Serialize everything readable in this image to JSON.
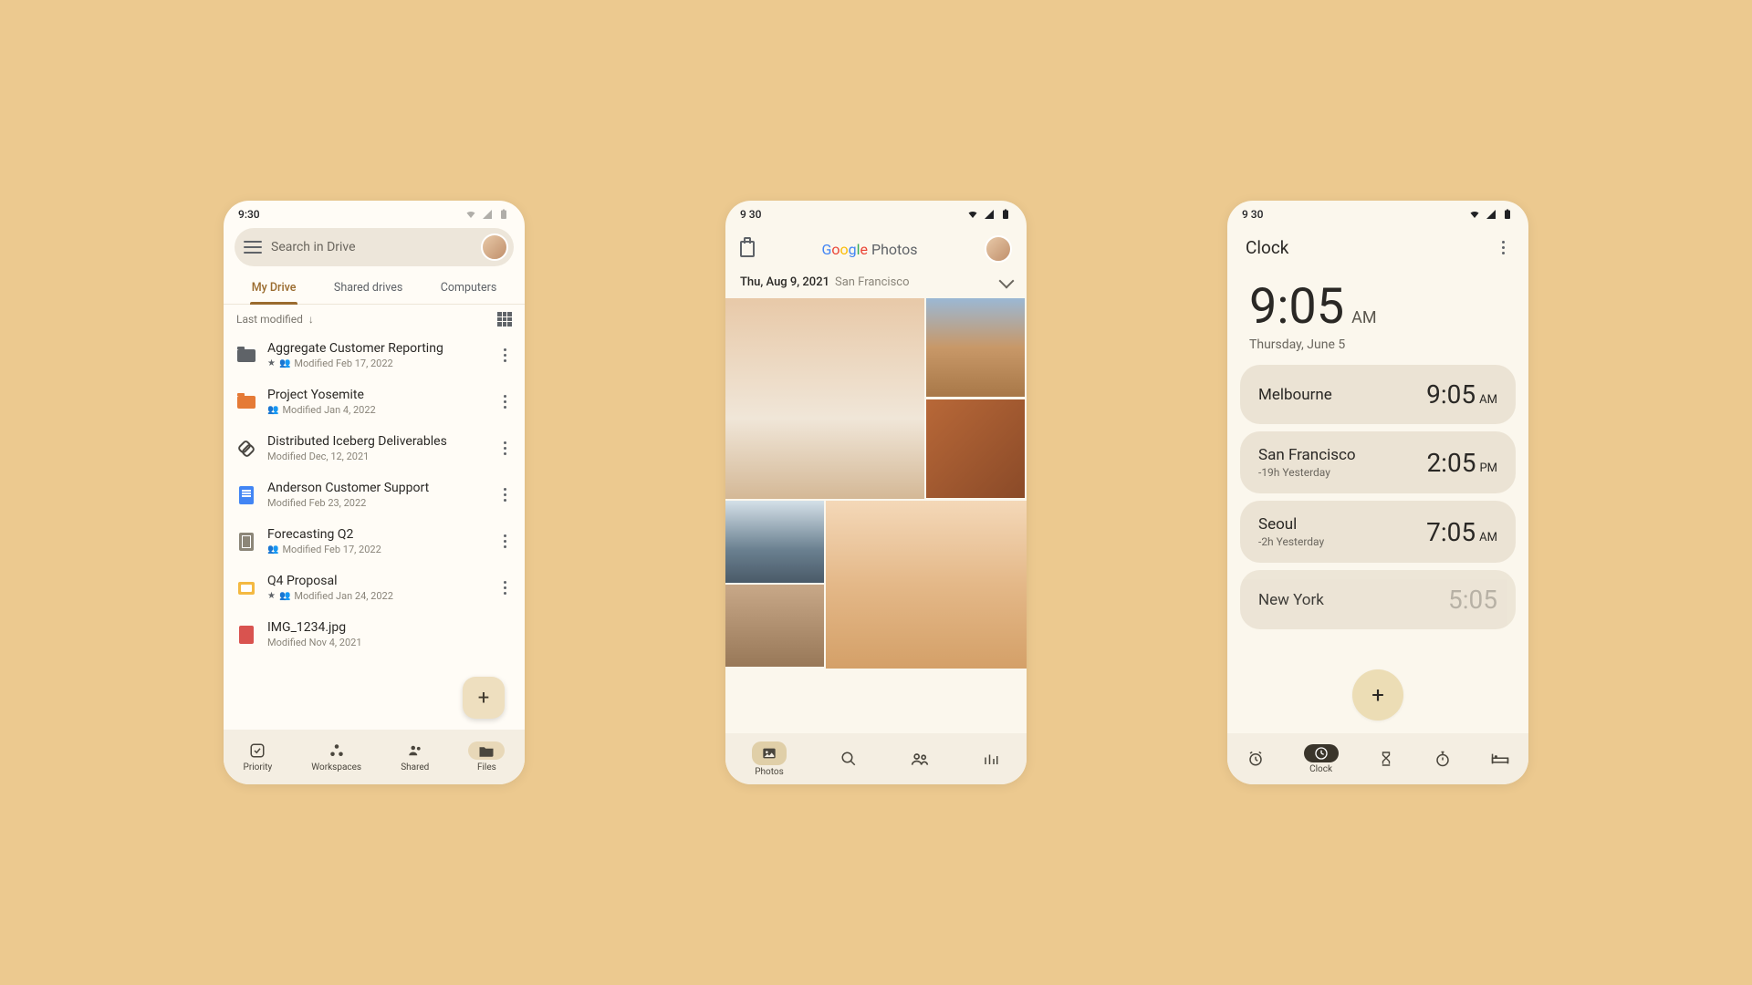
{
  "drive": {
    "status_time": "9:30",
    "search_placeholder": "Search in Drive",
    "tabs": [
      "My Drive",
      "Shared drives",
      "Computers"
    ],
    "sort_label": "Last modified",
    "files": [
      {
        "name": "Aggregate Customer Reporting",
        "meta": "Modified Feb 17, 2022",
        "starred": true,
        "shared": true
      },
      {
        "name": "Project Yosemite",
        "meta": "Modified Jan 4, 2022",
        "shared": true
      },
      {
        "name": "Distributed Iceberg Deliverables",
        "meta": "Modified Dec, 12, 2021"
      },
      {
        "name": "Anderson Customer Support",
        "meta": "Modified Feb 23, 2022"
      },
      {
        "name": "Forecasting Q2",
        "meta": "Modified Feb 17, 2022",
        "shared": true
      },
      {
        "name": "Q4 Proposal",
        "meta": "Modified Jan 24, 2022",
        "starred": true,
        "shared": true
      },
      {
        "name": "IMG_1234.jpg",
        "meta": "Modified Nov 4, 2021"
      }
    ],
    "nav": [
      "Priority",
      "Workspaces",
      "Shared",
      "Files"
    ]
  },
  "photos": {
    "status_time": "9 30",
    "logo_rest": " Photos",
    "date": "Thu, Aug 9, 2021",
    "location": "San Francisco",
    "nav_label": "Photos"
  },
  "clock": {
    "status_time": "9 30",
    "title": "Clock",
    "big_time": "9:05",
    "big_ampm": "AM",
    "big_date": "Thursday, June 5",
    "cities": [
      {
        "name": "Melbourne",
        "time": "9:05",
        "ampm": "AM",
        "offset": ""
      },
      {
        "name": "San Francisco",
        "time": "2:05",
        "ampm": "PM",
        "offset": "-19h  Yesterday"
      },
      {
        "name": "Seoul",
        "time": "7:05",
        "ampm": "AM",
        "offset": "-2h  Yesterday"
      },
      {
        "name": "New York",
        "time": "5:05",
        "ampm": "",
        "offset": ""
      }
    ],
    "nav_label": "Clock"
  }
}
